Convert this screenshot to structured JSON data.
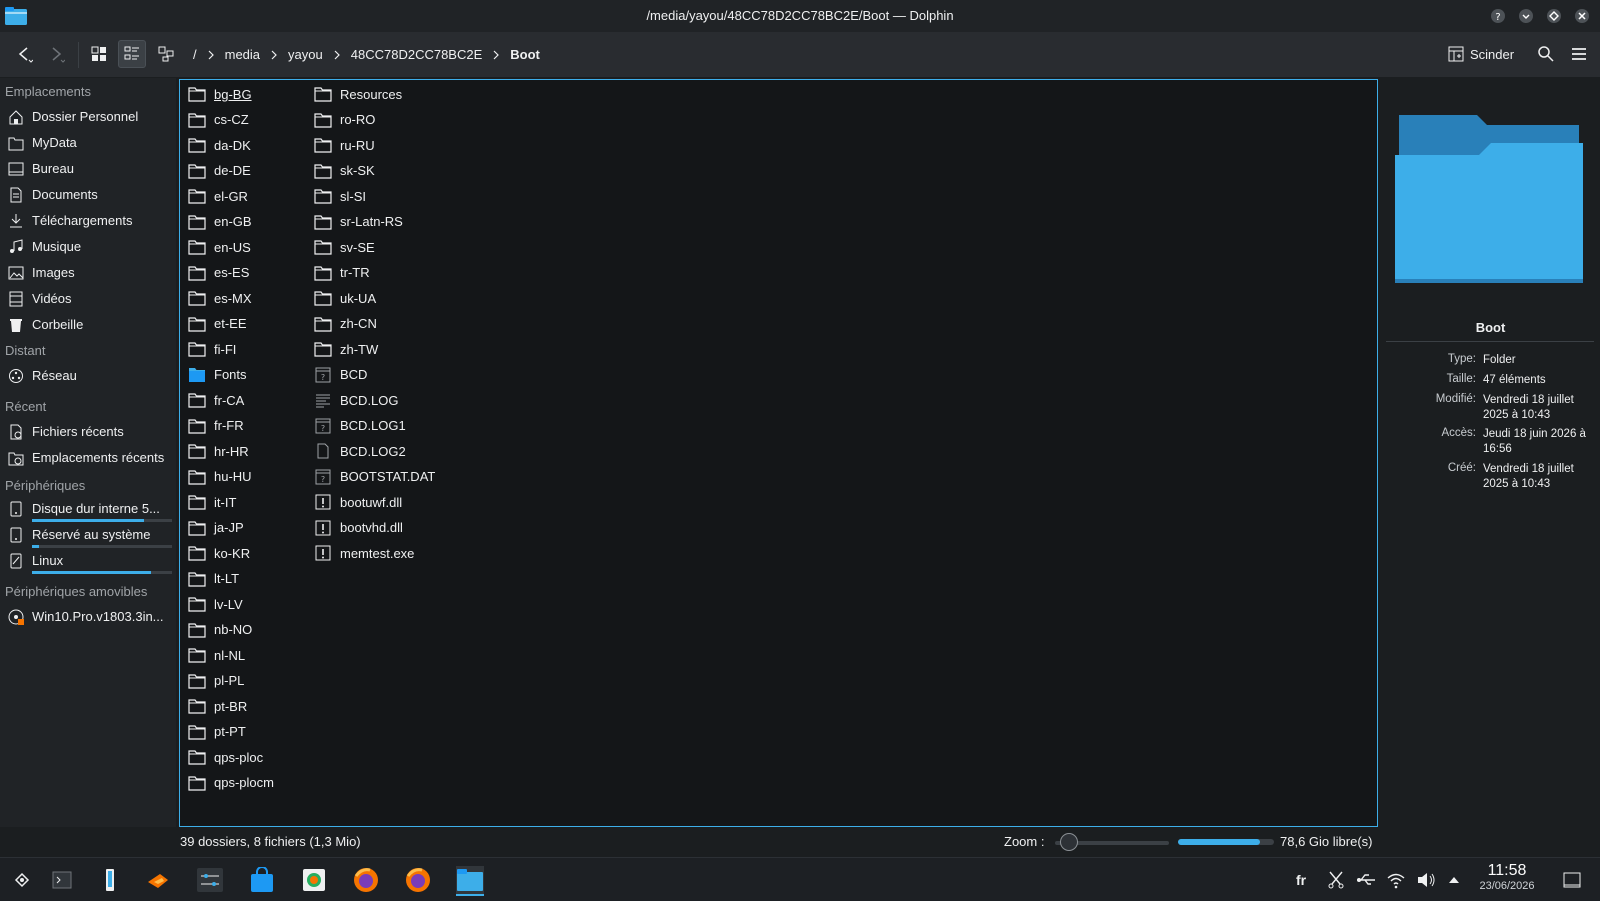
{
  "window": {
    "title": "/media/yayou/48CC78D2CC78BC2E/Boot — Dolphin"
  },
  "toolbar": {
    "breadcrumb": [
      "/",
      "media",
      "yayou",
      "48CC78D2CC78BC2E",
      "Boot"
    ],
    "split_label": "Scinder"
  },
  "sidebar": {
    "sections": {
      "places": "Emplacements",
      "remote": "Distant",
      "recent": "Récent",
      "devices": "Périphériques",
      "removable": "Périphériques amovibles"
    },
    "places": [
      "Dossier Personnel",
      "MyData",
      "Bureau",
      "Documents",
      "Téléchargements",
      "Musique",
      "Images",
      "Vidéos",
      "Corbeille"
    ],
    "remote": [
      "Réseau"
    ],
    "recent": [
      "Fichiers récents",
      "Emplacements récents"
    ],
    "devices": [
      {
        "label": "Disque dur interne 5...",
        "usage": 0.8
      },
      {
        "label": "Réservé au système",
        "usage": 0.05
      },
      {
        "label": "Linux",
        "usage": 0.85
      }
    ],
    "removable": [
      "Win10.Pro.v1803.3in..."
    ]
  },
  "files": {
    "column1": [
      {
        "name": "bg-BG",
        "type": "folder"
      },
      {
        "name": "cs-CZ",
        "type": "folder"
      },
      {
        "name": "da-DK",
        "type": "folder"
      },
      {
        "name": "de-DE",
        "type": "folder"
      },
      {
        "name": "el-GR",
        "type": "folder"
      },
      {
        "name": "en-GB",
        "type": "folder"
      },
      {
        "name": "en-US",
        "type": "folder"
      },
      {
        "name": "es-ES",
        "type": "folder"
      },
      {
        "name": "es-MX",
        "type": "folder"
      },
      {
        "name": "et-EE",
        "type": "folder"
      },
      {
        "name": "fi-FI",
        "type": "folder"
      },
      {
        "name": "Fonts",
        "type": "folder-blue"
      },
      {
        "name": "fr-CA",
        "type": "folder"
      },
      {
        "name": "fr-FR",
        "type": "folder"
      },
      {
        "name": "hr-HR",
        "type": "folder"
      },
      {
        "name": "hu-HU",
        "type": "folder"
      },
      {
        "name": "it-IT",
        "type": "folder"
      },
      {
        "name": "ja-JP",
        "type": "folder"
      },
      {
        "name": "ko-KR",
        "type": "folder"
      },
      {
        "name": "lt-LT",
        "type": "folder"
      },
      {
        "name": "lv-LV",
        "type": "folder"
      },
      {
        "name": "nb-NO",
        "type": "folder"
      },
      {
        "name": "nl-NL",
        "type": "folder"
      },
      {
        "name": "pl-PL",
        "type": "folder"
      },
      {
        "name": "pt-BR",
        "type": "folder"
      },
      {
        "name": "pt-PT",
        "type": "folder"
      },
      {
        "name": "qps-ploc",
        "type": "folder"
      },
      {
        "name": "qps-plocm",
        "type": "folder"
      }
    ],
    "column2": [
      {
        "name": "Resources",
        "type": "folder"
      },
      {
        "name": "ro-RO",
        "type": "folder"
      },
      {
        "name": "ru-RU",
        "type": "folder"
      },
      {
        "name": "sk-SK",
        "type": "folder"
      },
      {
        "name": "sl-SI",
        "type": "folder"
      },
      {
        "name": "sr-Latn-RS",
        "type": "folder"
      },
      {
        "name": "sv-SE",
        "type": "folder"
      },
      {
        "name": "tr-TR",
        "type": "folder"
      },
      {
        "name": "uk-UA",
        "type": "folder"
      },
      {
        "name": "zh-CN",
        "type": "folder"
      },
      {
        "name": "zh-TW",
        "type": "folder"
      },
      {
        "name": "BCD",
        "type": "unknown"
      },
      {
        "name": "BCD.LOG",
        "type": "text"
      },
      {
        "name": "BCD.LOG1",
        "type": "unknown"
      },
      {
        "name": "BCD.LOG2",
        "type": "blank"
      },
      {
        "name": "BOOTSTAT.DAT",
        "type": "unknown"
      },
      {
        "name": "bootuwf.dll",
        "type": "exec"
      },
      {
        "name": "bootvhd.dll",
        "type": "exec"
      },
      {
        "name": "memtest.exe",
        "type": "exec"
      }
    ]
  },
  "info": {
    "name": "Boot",
    "rows": [
      {
        "key": "Type:",
        "value": "Folder"
      },
      {
        "key": "Taille:",
        "value": "47 éléments"
      },
      {
        "key": "Modifié:",
        "value": "Vendredi 18 juillet 2025 à 10:43"
      },
      {
        "key": "Accès:",
        "value": "Jeudi 18 juin 2026 à 16:56"
      },
      {
        "key": "Créé:",
        "value": "Vendredi 18 juillet 2025 à 10:43"
      }
    ]
  },
  "status": {
    "summary": "39 dossiers, 8 fichiers (1,3 Mio)",
    "zoom_label": "Zoom :",
    "zoom_level": 0.05,
    "free_fraction": 0.85,
    "free_space": "78,6 Gio libre(s)"
  },
  "taskbar": {
    "lang": "fr",
    "time": "11:58",
    "date": "23/06/2026"
  },
  "colors": {
    "accent": "#3daee9",
    "bg": "#1b1e20",
    "panel": "#202326"
  }
}
